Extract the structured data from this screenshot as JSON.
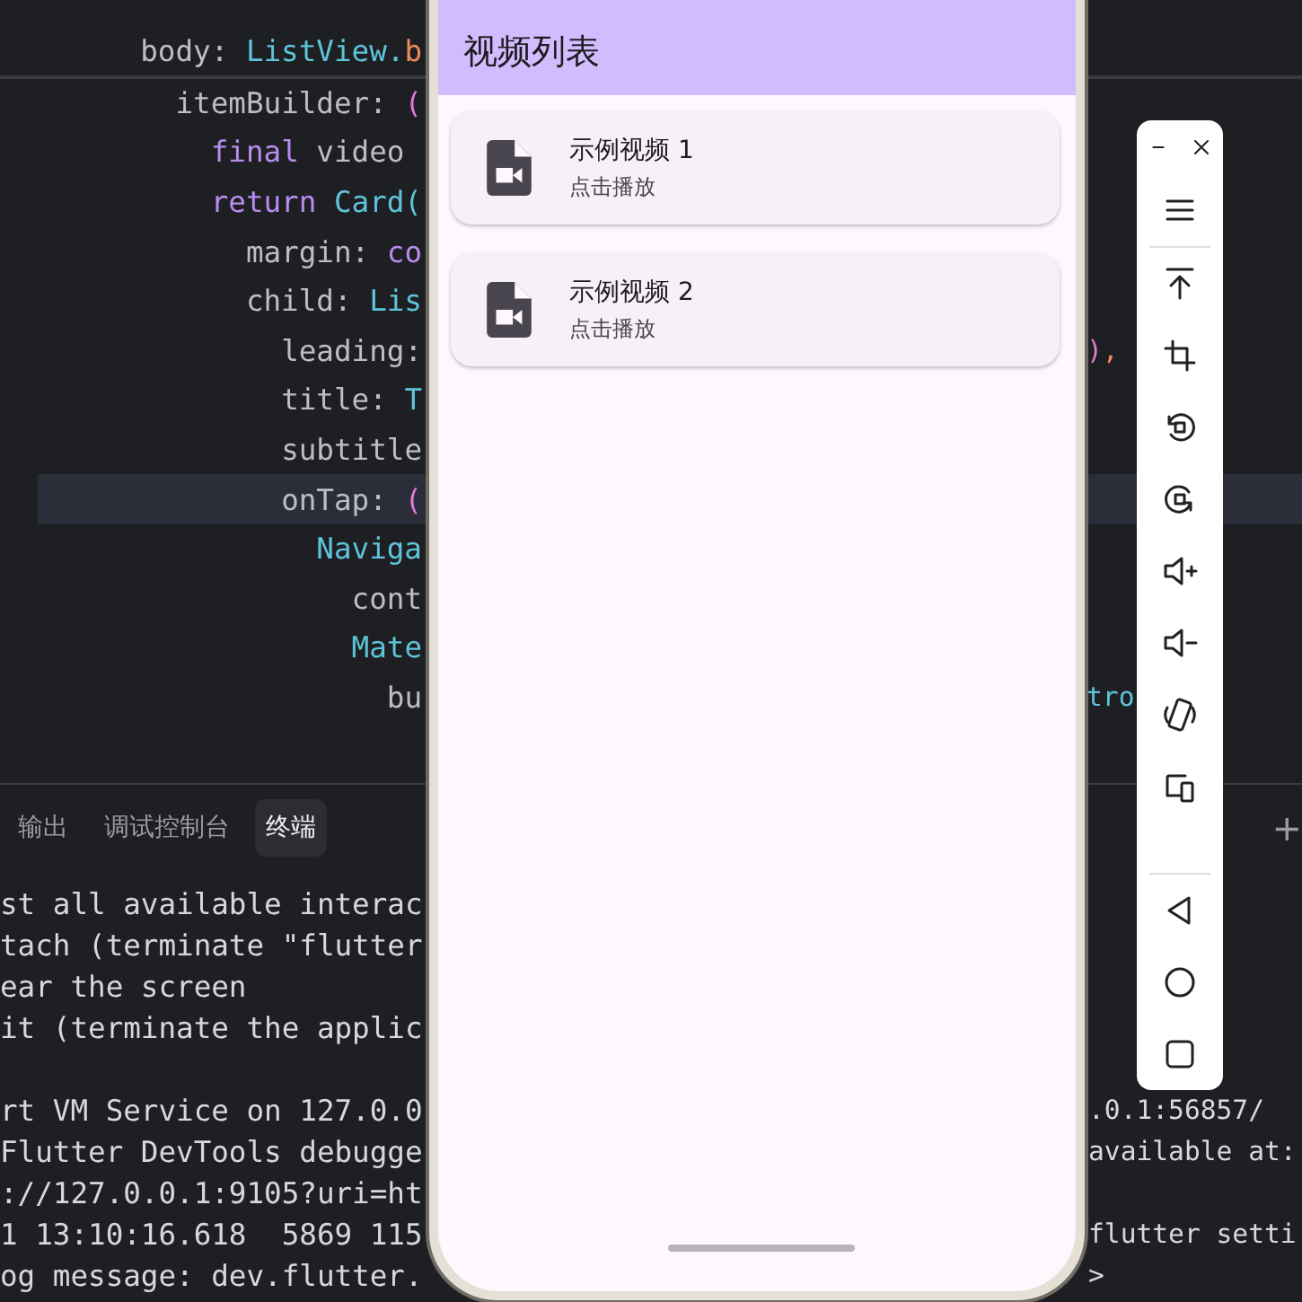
{
  "editor": {
    "lines": [
      {
        "code": [
          {
            "text": "body: ",
            "kind": "plain"
          },
          {
            "text": "ListView.",
            "kind": "type"
          },
          {
            "text": "b",
            "kind": "method"
          }
        ],
        "current": false
      },
      {
        "code": [
          {
            "text": "itemBuilder: ",
            "kind": "plain"
          },
          {
            "text": "(",
            "kind": "paren"
          }
        ],
        "current": false
      },
      {
        "code": [
          {
            "text": "final",
            "kind": "keyword"
          },
          {
            "text": " video ",
            "kind": "plain"
          }
        ],
        "current": false
      },
      {
        "code": [
          {
            "text": "return",
            "kind": "keyword"
          },
          {
            "text": " Card(",
            "kind": "type"
          }
        ],
        "current": false
      },
      {
        "code": [
          {
            "text": "margin: ",
            "kind": "plain"
          },
          {
            "text": "co",
            "kind": "keyword"
          }
        ],
        "current": false
      },
      {
        "code": [
          {
            "text": "child: ",
            "kind": "plain"
          },
          {
            "text": "Lis",
            "kind": "type"
          }
        ],
        "current": false
      },
      {
        "code": [
          {
            "text": "leading:",
            "kind": "plain"
          }
        ],
        "right": [
          {
            "text": ")",
            "kind": "paren"
          },
          {
            "text": ",",
            "kind": "method"
          }
        ],
        "current": false
      },
      {
        "code": [
          {
            "text": "title: ",
            "kind": "plain"
          },
          {
            "text": "T",
            "kind": "type"
          }
        ],
        "current": false
      },
      {
        "code": [
          {
            "text": "subtitle",
            "kind": "plain"
          }
        ],
        "current": false
      },
      {
        "code": [
          {
            "text": "onTap: ",
            "kind": "plain"
          },
          {
            "text": "(",
            "kind": "paren"
          }
        ],
        "current": true
      },
      {
        "code": [
          {
            "text": "Naviga",
            "kind": "type"
          }
        ],
        "current": false
      },
      {
        "code": [
          {
            "text": "cont",
            "kind": "plain"
          }
        ],
        "current": false
      },
      {
        "code": [
          {
            "text": "Mate",
            "kind": "type"
          }
        ],
        "current": false
      },
      {
        "code": [
          {
            "text": "bu",
            "kind": "plain"
          }
        ],
        "right": [
          {
            "text": "tro",
            "kind": "type"
          }
        ],
        "current": false
      }
    ]
  },
  "panel": {
    "tabs": [
      {
        "label": "输出",
        "selected": false
      },
      {
        "label": "调试控制台",
        "selected": false
      },
      {
        "label": "终端",
        "selected": true
      }
    ],
    "add": "+"
  },
  "terminal": {
    "blocks": [
      [
        {
          "text": "st all available interac"
        },
        {
          "text": "tach (terminate \"flutter"
        },
        {
          "text": "ear the screen"
        },
        {
          "text": "it (terminate the applic"
        }
      ],
      [
        {
          "text": "rt VM Service on 127.0.0",
          "right": ".0.1:56857/"
        },
        {
          "text": "Flutter DevTools debugge",
          "right": "available at:"
        },
        {
          "text": "://127.0.0.1:9105?uri=ht"
        },
        {
          "text": "1 13:10:16.618  5869 115",
          "right": "flutter setti"
        },
        {
          "text": "og message: dev.flutter.",
          "right": ">"
        }
      ]
    ]
  },
  "app": {
    "title": "视频列表",
    "videos": [
      {
        "title": "示例视频 1",
        "subtitle": "点击播放"
      },
      {
        "title": "示例视频 2",
        "subtitle": "点击播放"
      }
    ]
  }
}
